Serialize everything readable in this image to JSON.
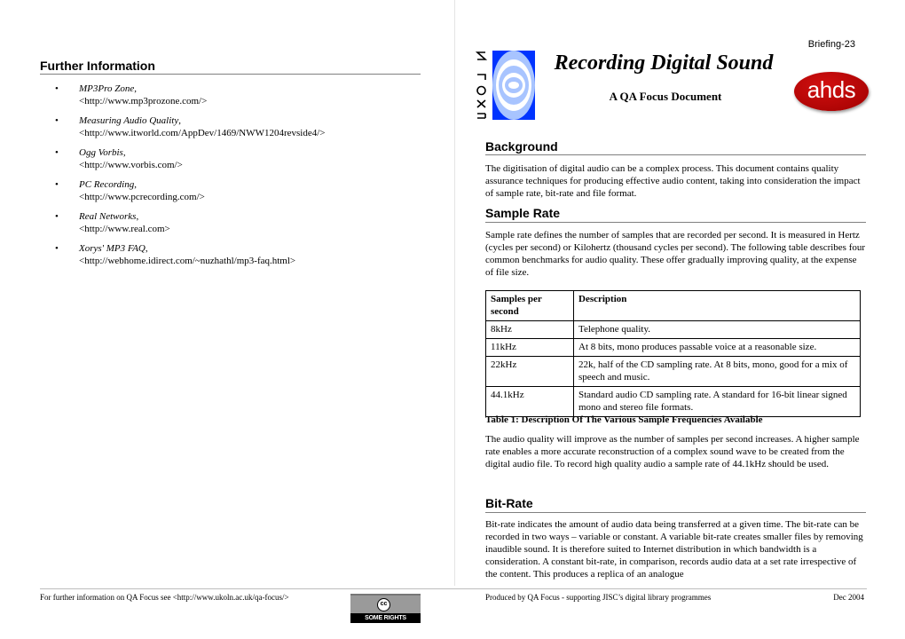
{
  "header": {
    "briefing": "Briefing-23",
    "title": "Recording Digital Sound",
    "subtitle": "A QA Focus Document",
    "logo_left": "UKOLN",
    "logo_right": "ahds",
    "colors": {
      "ukoln_blue": "#0033ff",
      "ukoln_light": "#a8c4ff",
      "ahds_red": "#b40000"
    }
  },
  "further_info": {
    "heading": "Further Information",
    "items": [
      {
        "title": "MP3Pro Zone",
        "url": "<http://www.mp3prozone.com/>"
      },
      {
        "title": "Measuring Audio Quality",
        "url": "<http://www.itworld.com/AppDev/1469/NWW1204revside4/>"
      },
      {
        "title": "Ogg Vorbis",
        "url": "<http://www.vorbis.com/>"
      },
      {
        "title": "PC Recording",
        "url": "<http://www.pcrecording.com/>"
      },
      {
        "title": "Real Networks",
        "url": "<http://www.real.com>"
      },
      {
        "title": "Xorys' MP3 FAQ",
        "url": "<http://webhome.idirect.com/~nuzhathl/mp3-faq.html>"
      }
    ]
  },
  "background": {
    "heading": "Background",
    "text": "The digitisation of digital audio can be a complex process. This document contains quality assurance techniques for producing effective audio content, taking into consideration the impact of sample rate, bit-rate and file format."
  },
  "sample_rate": {
    "heading": "Sample Rate",
    "text": "Sample rate defines the number of samples that are recorded per second. It is measured in Hertz (cycles per second) or Kilohertz (thousand cycles per second). The following table describes four common benchmarks for audio quality. These offer gradually improving quality, at the expense of file size.",
    "table": {
      "headers": [
        "Samples per second",
        "Description"
      ],
      "rows": [
        [
          "8kHz",
          "Telephone quality."
        ],
        [
          "11kHz",
          "At 8 bits, mono produces passable voice at a reasonable size."
        ],
        [
          "22kHz",
          "22k, half of the CD sampling rate. At 8 bits, mono, good for a mix of speech and music."
        ],
        [
          "44.1kHz",
          "Standard audio CD sampling rate. A standard for 16-bit linear signed mono and stereo file formats."
        ]
      ],
      "caption": "Table 1: Description Of The Various Sample Frequencies Available"
    },
    "text2": "The audio quality will improve as the number of samples per second increases. A higher sample rate enables a more accurate reconstruction of a complex sound wave to be created from the digital audio file. To record high quality audio a sample rate of 44.1kHz should be used."
  },
  "bit_rate": {
    "heading": "Bit-Rate",
    "text": "Bit-rate indicates the amount of audio data being transferred at a given time. The bit-rate can be recorded in two ways – variable or constant. A variable bit-rate creates smaller files by removing inaudible sound. It is therefore suited to Internet distribution in which bandwidth is a consideration. A constant bit-rate, in comparison, records audio data at a set rate irrespective of the content. This produces a replica of an analogue"
  },
  "footer": {
    "left": "For further information on QA Focus see <http://www.ukoln.ac.uk/qa-focus/>",
    "cc_badge": "SOME RIGHTS RESERVED",
    "center": "Produced by QA Focus - supporting JISC’s digital library programmes",
    "date": "Dec 2004"
  }
}
